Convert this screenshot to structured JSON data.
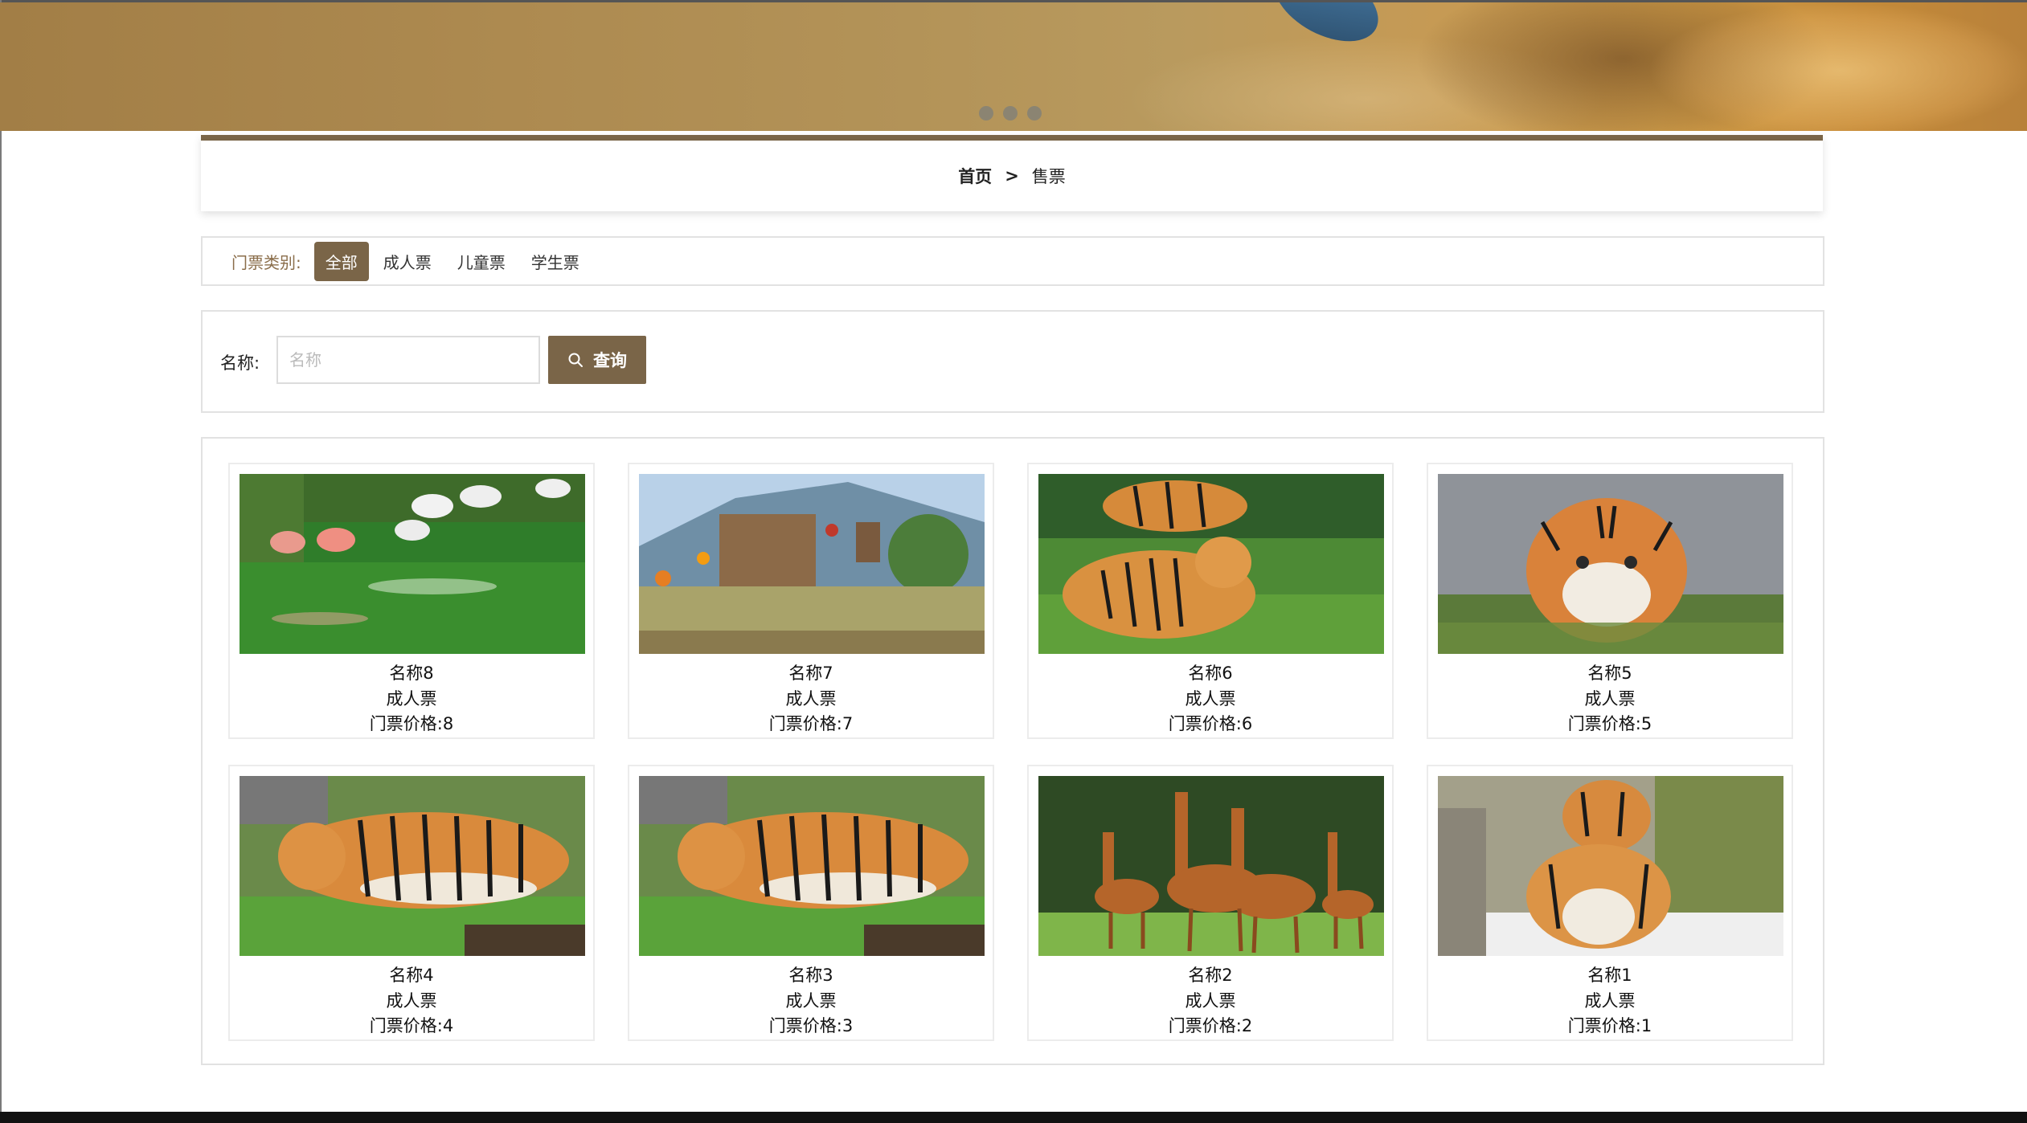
{
  "banner": {
    "slides": [
      "slide-1",
      "slide-2",
      "slide-3"
    ]
  },
  "breadcrumb": {
    "home": "首页",
    "separator": ">",
    "current": "售票"
  },
  "filter": {
    "label": "门票类别:",
    "options": [
      "全部",
      "成人票",
      "儿童票",
      "学生票"
    ],
    "active_index": 0
  },
  "search": {
    "label": "名称:",
    "placeholder": "名称",
    "value": "",
    "button": "查询"
  },
  "tickets": [
    {
      "name": "名称8",
      "category": "成人票",
      "price": "门票价格:8",
      "image": "flamingos"
    },
    {
      "name": "名称7",
      "category": "成人票",
      "price": "门票价格:7",
      "image": "zoo-landscape"
    },
    {
      "name": "名称6",
      "category": "成人票",
      "price": "门票价格:6",
      "image": "tigers-grass"
    },
    {
      "name": "名称5",
      "category": "成人票",
      "price": "门票价格:5",
      "image": "tiger-water"
    },
    {
      "name": "名称4",
      "category": "成人票",
      "price": "门票价格:4",
      "image": "tiger-walking"
    },
    {
      "name": "名称3",
      "category": "成人票",
      "price": "门票价格:3",
      "image": "tiger-walking"
    },
    {
      "name": "名称2",
      "category": "成人票",
      "price": "门票价格:2",
      "image": "giraffes"
    },
    {
      "name": "名称1",
      "category": "成人票",
      "price": "门票价格:1",
      "image": "tiger-cubs-snow"
    }
  ],
  "colors": {
    "accent": "#7a6548",
    "filter_label": "#8a6d4a",
    "border": "#e2e2e2"
  }
}
